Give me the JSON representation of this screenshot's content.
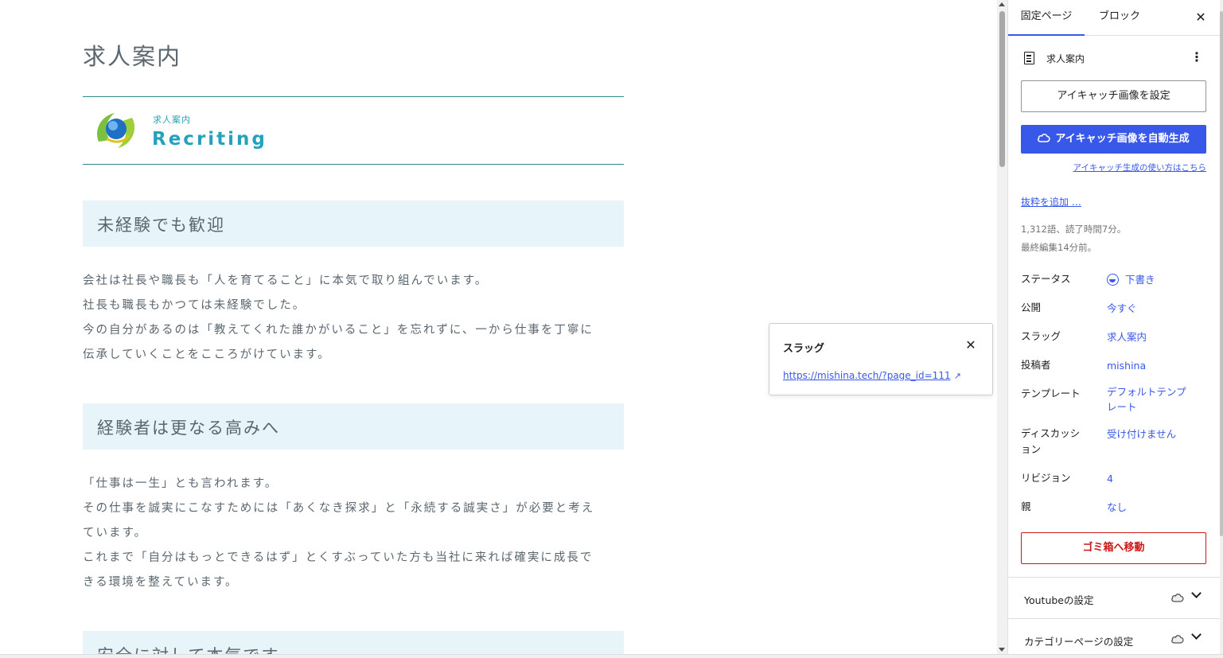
{
  "page": {
    "title": "求人案内",
    "header_block": {
      "sub": "求人案内",
      "main": "Recriting"
    },
    "sections": [
      {
        "heading": "未経験でも歓迎",
        "lines": [
          "会社は社長や職長も「人を育てること」に本気で取り組んでいます。",
          "社長も職長もかつては未経験でした。",
          "今の自分があるのは「教えてくれた誰かがいること」を忘れずに、一から仕事を丁寧に",
          "伝承していくことをこころがけています。"
        ]
      },
      {
        "heading": "経験者は更なる高みへ",
        "lines": [
          "「仕事は一生」とも言われます。",
          "その仕事を誠実にこなすためには「あくなき探求」と「永続する誠実さ」が必要と考え",
          "ています。",
          "これまで「自分はもっとできるはず」とくすぶっていた方も当社に来れば確実に成長で",
          "きる環境を整えています。"
        ]
      },
      {
        "heading": "安全に対して本気です",
        "lines": []
      }
    ]
  },
  "popover": {
    "title": "スラッグ",
    "close_icon": "close-icon",
    "link": "https://mishina.tech/?page_id=111",
    "link_icon": "↗"
  },
  "sidebar": {
    "tabs": [
      "固定ページ",
      "ブロック"
    ],
    "close_icon": "close-icon",
    "document": {
      "title": "求人案内",
      "icon": "page-icon",
      "menu_icon": "⋮"
    },
    "set_featured_label": "アイキャッチ画像を設定",
    "auto_featured_label": "アイキャッチ画像を自動生成",
    "howto_link": "アイキャッチ生成の使い方はこちら",
    "excerpt_link": "抜粋を追加 …",
    "word_count": "1,312語、読了時間7分。",
    "last_edited": "最終編集14分前。",
    "rows": [
      {
        "label": "ステータス",
        "value": "下書き"
      },
      {
        "label": "公開",
        "value": "今すぐ"
      },
      {
        "label": "スラッグ",
        "value": "求人案内"
      },
      {
        "label": "投稿者",
        "value": "mishina"
      },
      {
        "label": "テンプレート",
        "value": "デフォルトテンプレート"
      },
      {
        "label": "ディスカッション",
        "value": "受け付けません"
      },
      {
        "label": "リビジョン",
        "value": "4"
      },
      {
        "label": "親",
        "value": "なし"
      }
    ],
    "trash_label": "ゴミ箱へ移動",
    "panels": [
      "Youtubeの設定",
      "カテゴリーページの設定"
    ]
  },
  "colors": {
    "accent": "#3858e9",
    "danger": "#cc1818",
    "heading_bg": "#e7f4fa",
    "body_text": "#5b6770",
    "brand_teal": "#24a2bd"
  }
}
